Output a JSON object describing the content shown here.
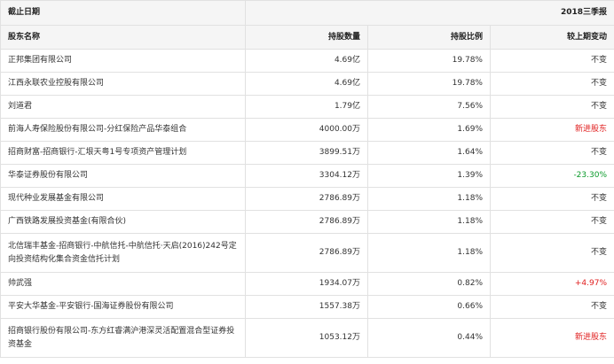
{
  "table": {
    "period_label": "截止日期",
    "period_value": "2018三季报",
    "headers": [
      "股东名称",
      "持股数量",
      "持股比例",
      "较上期变动"
    ],
    "rows": [
      {
        "name": "正邦集团有限公司",
        "shares": "4.69亿",
        "ratio": "19.78%",
        "change": "不变"
      },
      {
        "name": "江西永联农业控股有限公司",
        "shares": "4.69亿",
        "ratio": "19.78%",
        "change": "不变"
      },
      {
        "name": "刘道君",
        "shares": "1.79亿",
        "ratio": "7.56%",
        "change": "不变"
      },
      {
        "name": "前海人寿保险股份有限公司-分红保险产品华泰组合",
        "shares": "4000.00万",
        "ratio": "1.69%",
        "change": "新进股东"
      },
      {
        "name": "招商财富-招商银行-汇垠天粤1号专项资产管理计划",
        "shares": "3899.51万",
        "ratio": "1.64%",
        "change": "不变"
      },
      {
        "name": "华泰证券股份有限公司",
        "shares": "3304.12万",
        "ratio": "1.39%",
        "change": "-23.30%"
      },
      {
        "name": "现代种业发展基金有限公司",
        "shares": "2786.89万",
        "ratio": "1.18%",
        "change": "不变"
      },
      {
        "name": "广西铁路发展投资基金(有限合伙)",
        "shares": "2786.89万",
        "ratio": "1.18%",
        "change": "不变"
      },
      {
        "name": "北信瑞丰基金-招商银行-中航信托-中航信托·天启(2016)242号定向投资结构化集合资金信托计划",
        "shares": "2786.89万",
        "ratio": "1.18%",
        "change": "不变"
      },
      {
        "name": "帅武强",
        "shares": "1934.07万",
        "ratio": "0.82%",
        "change": "+4.97%"
      },
      {
        "name": "平安大华基金-平安银行-国海证券股份有限公司",
        "shares": "1557.38万",
        "ratio": "0.66%",
        "change": "不变"
      },
      {
        "name": "招商银行股份有限公司-东方红睿满沪港深灵活配置混合型证券投资基金",
        "shares": "1053.12万",
        "ratio": "0.44%",
        "change": "新进股东"
      }
    ]
  }
}
